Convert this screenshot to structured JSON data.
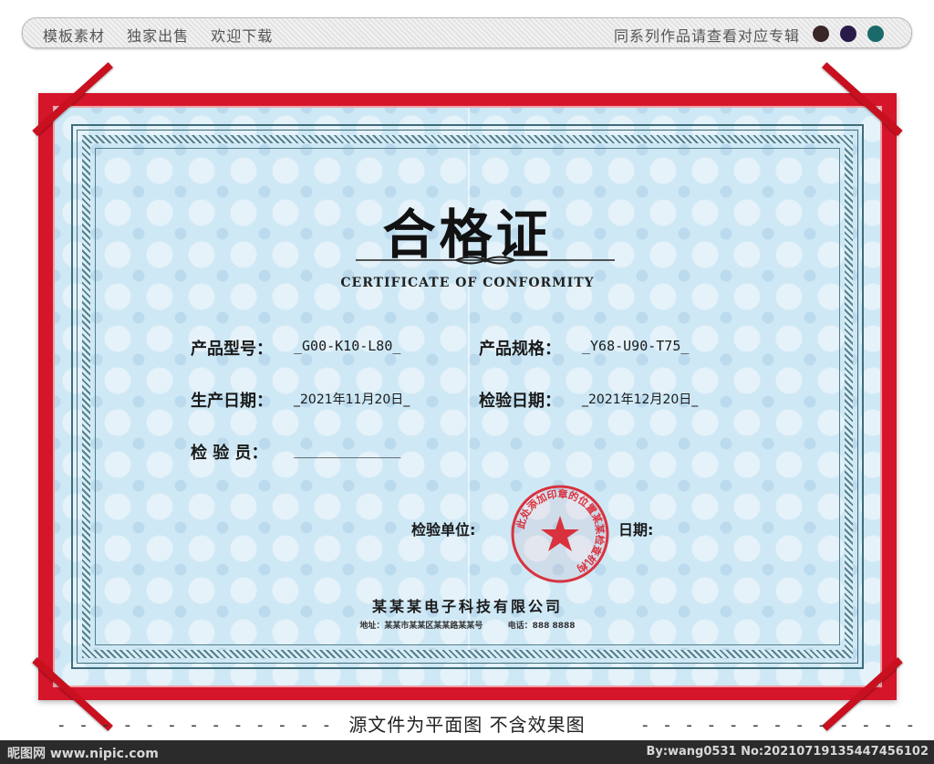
{
  "topbar": {
    "left_items": [
      "模板素材",
      "独家出售",
      "欢迎下载"
    ],
    "right_text": "同系列作品请查看对应专辑",
    "swatches": [
      "#3a2626",
      "#2a1a4a",
      "#1b6a6a"
    ]
  },
  "certificate": {
    "title": "合格证",
    "subtitle": "CERTIFICATE OF CONFORMITY",
    "fields": {
      "model_label": "产品型号：",
      "model_value": "_G00-K10-L80_",
      "model_blank": "_____________",
      "spec_label": "产品规格：",
      "spec_value": "_Y68-U90-T75_",
      "spec_blank": "_____________",
      "prod_date_label": "生产日期：",
      "prod_date_value": "_2021年11月20日_",
      "insp_date_label": "检验日期：",
      "insp_date_value": "_2021年12月20日_",
      "inspector_label": "检 验 员：",
      "inspector_blank": "_____________",
      "unit_label": "检验单位:",
      "date_label": "日期:"
    },
    "seal_text": "此处添加印章的位置某某检查机构",
    "company": "某某某电子科技有限公司",
    "address": "地址：某某市某某区某某路某某号",
    "phone": "电话：888 8888",
    "colors": {
      "frame": "#d5152a",
      "paper": "#cde9f7",
      "border": "#3f6c78",
      "seal": "#d9323e"
    }
  },
  "bottom": {
    "note": "源文件为平面图 不含效果图",
    "dashes_left": "- - - - - - - - - - - - -",
    "dashes_right": "- - - - - - - - - - - - -"
  },
  "footer": {
    "site": "昵图网 www.nipic.com",
    "id": "By:wang0531 No:20210719135447456102"
  }
}
